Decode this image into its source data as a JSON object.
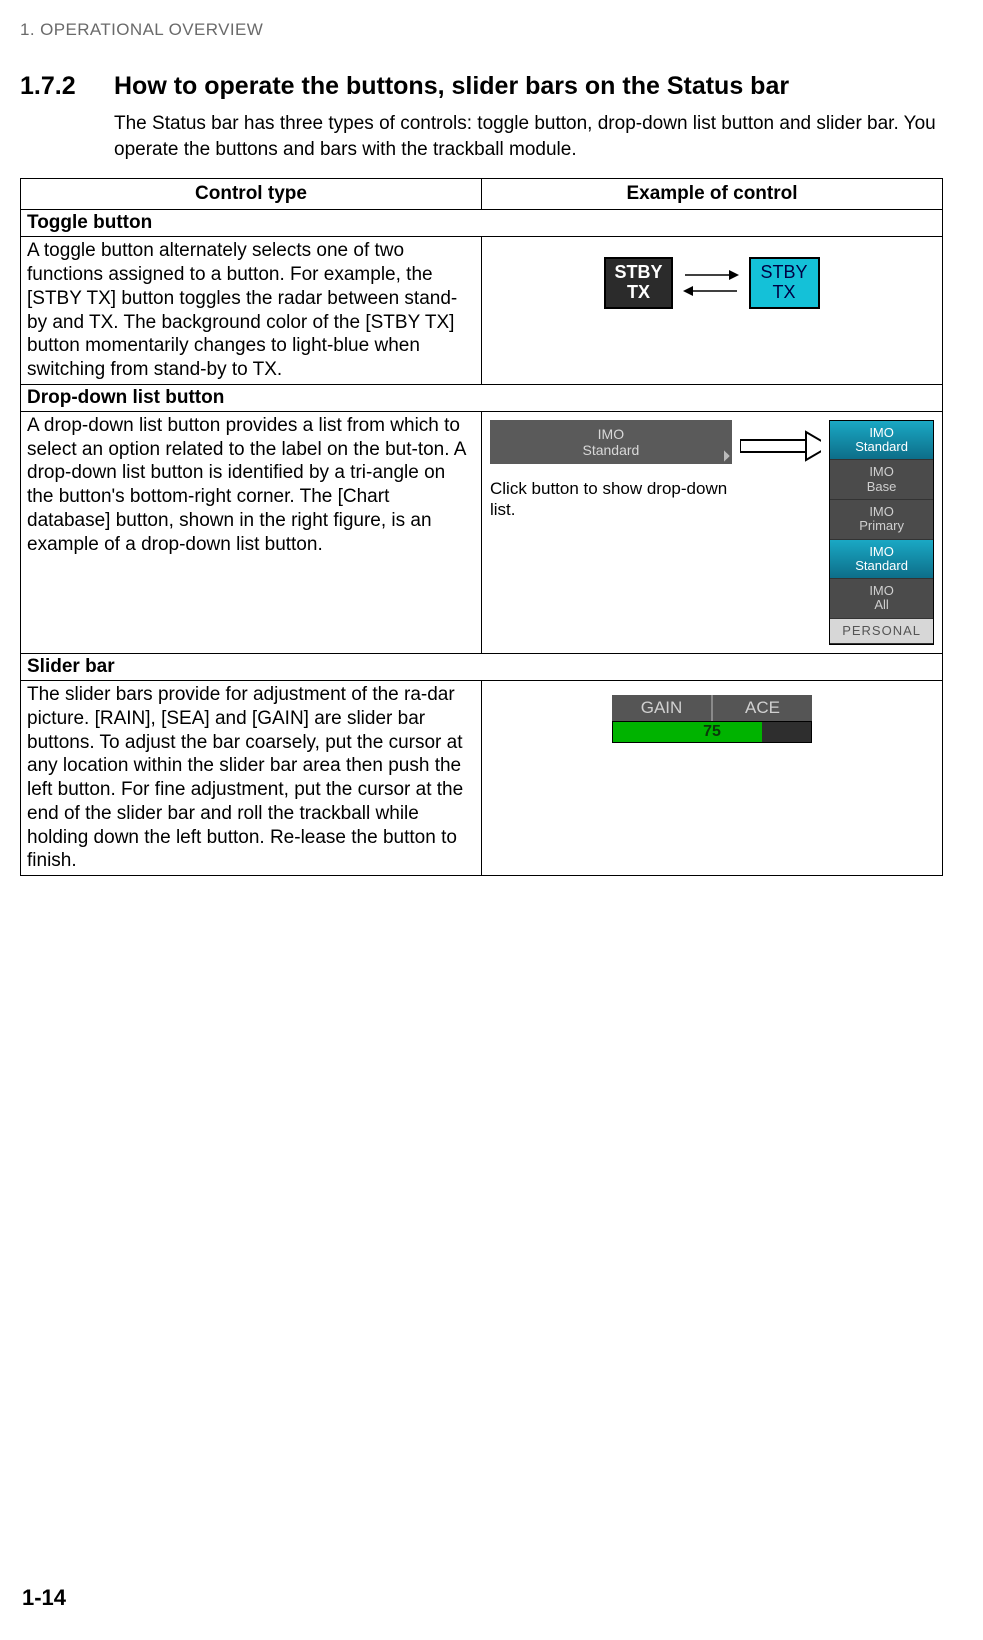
{
  "chapter": "1.  OPERATIONAL OVERVIEW",
  "section_number": "1.7.2",
  "section_title": "How to operate the buttons, slider bars on the Status bar",
  "intro": "The Status bar has three types of controls: toggle button, drop-down list button and slider bar. You operate the buttons and bars with the trackball module.",
  "table": {
    "head_left": "Control type",
    "head_right": "Example of control",
    "toggle": {
      "label": "Toggle button",
      "desc": "A toggle button alternately selects one of two functions assigned to a button. For example, the [STBY TX] button toggles the radar between stand-by and TX. The background color of the [STBY TX] button momentarily changes to light-blue when switching from stand-by to TX.",
      "btn1_l1": "STBY",
      "btn1_l2": "TX",
      "btn2_l1": "STBY",
      "btn2_l2": "TX"
    },
    "dropdown": {
      "label": "Drop-down list button",
      "desc": "A drop-down list button provides a list from which to select an option related to the label on the but-ton. A drop-down list button is identified by a tri-angle on the button's bottom-right corner. The [Chart database] button, shown in the right figure, is an example of a drop-down list button.",
      "btn_l1": "IMO",
      "btn_l2": "Standard",
      "caption": "Click button to show drop-down list.",
      "items": [
        {
          "l1": "IMO",
          "l2": "Standard",
          "sel": true
        },
        {
          "l1": "IMO",
          "l2": "Base",
          "sel": false
        },
        {
          "l1": "IMO",
          "l2": "Primary",
          "sel": false
        },
        {
          "l1": "IMO",
          "l2": "Standard",
          "sel": true
        },
        {
          "l1": "IMO",
          "l2": "All",
          "sel": false
        },
        {
          "l1": "PERSONAL",
          "l2": "",
          "sel": false,
          "personal": true
        }
      ]
    },
    "slider": {
      "label": "Slider bar",
      "desc": "The slider bars provide for adjustment of the ra-dar picture. [RAIN], [SEA] and [GAIN] are slider bar buttons. To adjust the bar coarsely, put the cursor at any location within the slider bar area then push the left button. For fine adjustment, put the cursor at the end of the slider bar and roll the trackball while holding down the left button. Re-lease the button to finish.",
      "head_left": "GAIN",
      "head_right": "ACE",
      "value": "75"
    }
  },
  "page_number": "1-14"
}
